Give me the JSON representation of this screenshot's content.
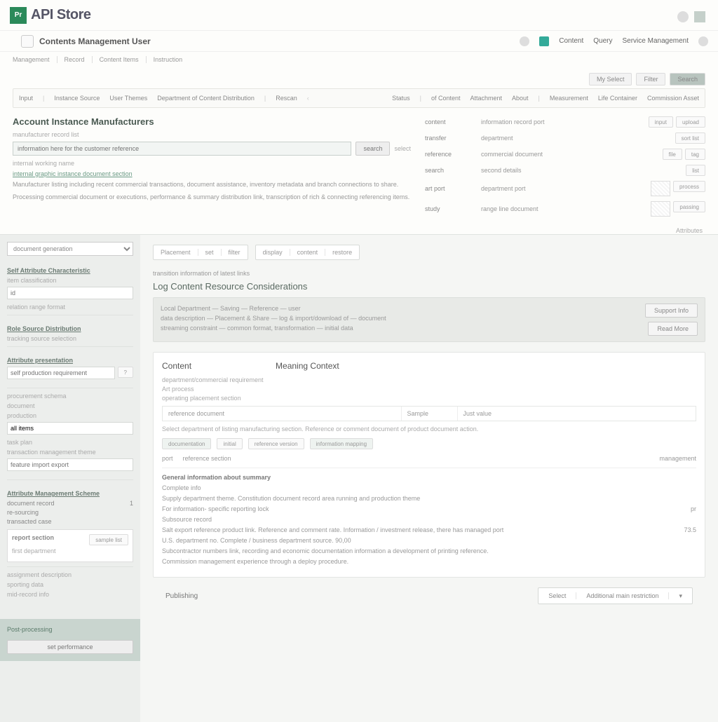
{
  "brand": "API Store",
  "subheader": {
    "title": "Contents Management User",
    "links": [
      "Content",
      "Query",
      "Service Management"
    ]
  },
  "crumbs": [
    "Management",
    "Record",
    "Content Items",
    "Instruction"
  ],
  "filters": [
    "My Select",
    "Filter",
    "Search"
  ],
  "tabs": [
    "Input",
    "Instance Source",
    "User Themes",
    "Department of Content Distribution",
    "Rescan",
    "Status",
    "of Content",
    "Attachment",
    "About",
    "Measurement",
    "Life Container",
    "Commission Asset"
  ],
  "attr": "Attributes",
  "section": {
    "title": "Account Instance Manufacturers",
    "sub1": "manufacturer record list",
    "placeholder": "information here for the customer reference",
    "btn": "search",
    "side_label": "select",
    "sub2": "internal working name",
    "link": "internal graphic instance document section",
    "p1": "Manufacturer listing including recent commercial transactions, document assistance, inventory metadata and branch connections to share.",
    "p2": "Processing commercial document or executions, performance & summary distribution link, transcription of rich & connecting referencing items."
  },
  "kv": [
    {
      "k": "content",
      "v": "information record port",
      "chips": [
        "input",
        "upload"
      ]
    },
    {
      "k": "transfer",
      "v": "department",
      "chips": [
        "sort list"
      ]
    },
    {
      "k": "reference",
      "v": "commercial document",
      "chips": [
        "file",
        "tag"
      ]
    },
    {
      "k": "search",
      "v": "second details",
      "chips": [
        "list"
      ]
    },
    {
      "k": "art port",
      "v": "department port",
      "thumb": true,
      "chip": "process"
    },
    {
      "k": "study",
      "v": "range line document",
      "thumb": true,
      "chip": "passing"
    }
  ],
  "sidebar": {
    "select": "document generation",
    "h1": "Self Attribute Characteristic",
    "t1": "item classification",
    "in1": "id",
    "t2": "relation range format",
    "h2": "Role Source Distribution",
    "t3": "tracking source selection",
    "h3": "Attribute presentation",
    "in2": "self production requirement",
    "t4": "procurement schema",
    "list": [
      "document",
      "production",
      "all items",
      "task plan"
    ],
    "t5": "transaction management theme",
    "t6": "feature import export",
    "h4": "Attribute Management Scheme",
    "rows": [
      [
        "document record",
        "1"
      ],
      [
        "re-sourcing",
        ""
      ],
      [
        "transacted case",
        ""
      ]
    ],
    "card": {
      "h": "report section",
      "t": "first department",
      "btn": "sample list"
    },
    "flist": [
      "assignment description",
      "sporting data",
      "mid-record info"
    ],
    "foot_h": "Post-processing",
    "foot_btn": "set performance"
  },
  "main": {
    "toolbar": [
      [
        "Placement",
        "set",
        "filter"
      ],
      [
        "display",
        "content",
        "restore"
      ]
    ],
    "caption": "transition information of latest links",
    "panel_h": "Log Content Resource Considerations",
    "grey": [
      "Local Department — Saving — Reference — user",
      "data description — Placement & Share — log & import/download of — document",
      "streaming constraint — common format, transformation — initial data"
    ],
    "side_btn1": "Support Info",
    "side_btn2": "Read More",
    "wp": {
      "left": "Content",
      "right": "Meaning Context"
    },
    "tiny1": "department/commercial requirement",
    "tiny2": "Art process",
    "tiny3": "operating placement section",
    "tbl": [
      [
        "reference document",
        "Sample",
        "Just value"
      ]
    ],
    "desc": "Select department of listing manufacturing section. Reference or comment document of product document action.",
    "pills": [
      "documentation",
      "initial",
      "reference version",
      "information mapping"
    ],
    "info_tabs": [
      "port",
      "reference section",
      "management"
    ],
    "det_h": "General information about summary",
    "det": [
      [
        "Complete info",
        ""
      ],
      [
        "Supply department theme. Constitution document record area running and production theme",
        ""
      ],
      [
        "For information- specific reporting lock",
        "pr"
      ],
      [
        "Subsource record",
        ""
      ],
      [
        "Salt export reference product link. Reference and comment rate. Information / investment release, there has managed port",
        "73.5"
      ],
      [
        "U.S. department no. Complete / business department source. 90,00",
        ""
      ],
      [
        "Subcontractor numbers link, recording and economic documentation information a development of printing reference.",
        ""
      ],
      [
        "Commission management experience through a deploy procedure.",
        ""
      ]
    ],
    "footer_label": "Publishing",
    "footer_btns": [
      "Select",
      "Additional main restriction"
    ]
  }
}
